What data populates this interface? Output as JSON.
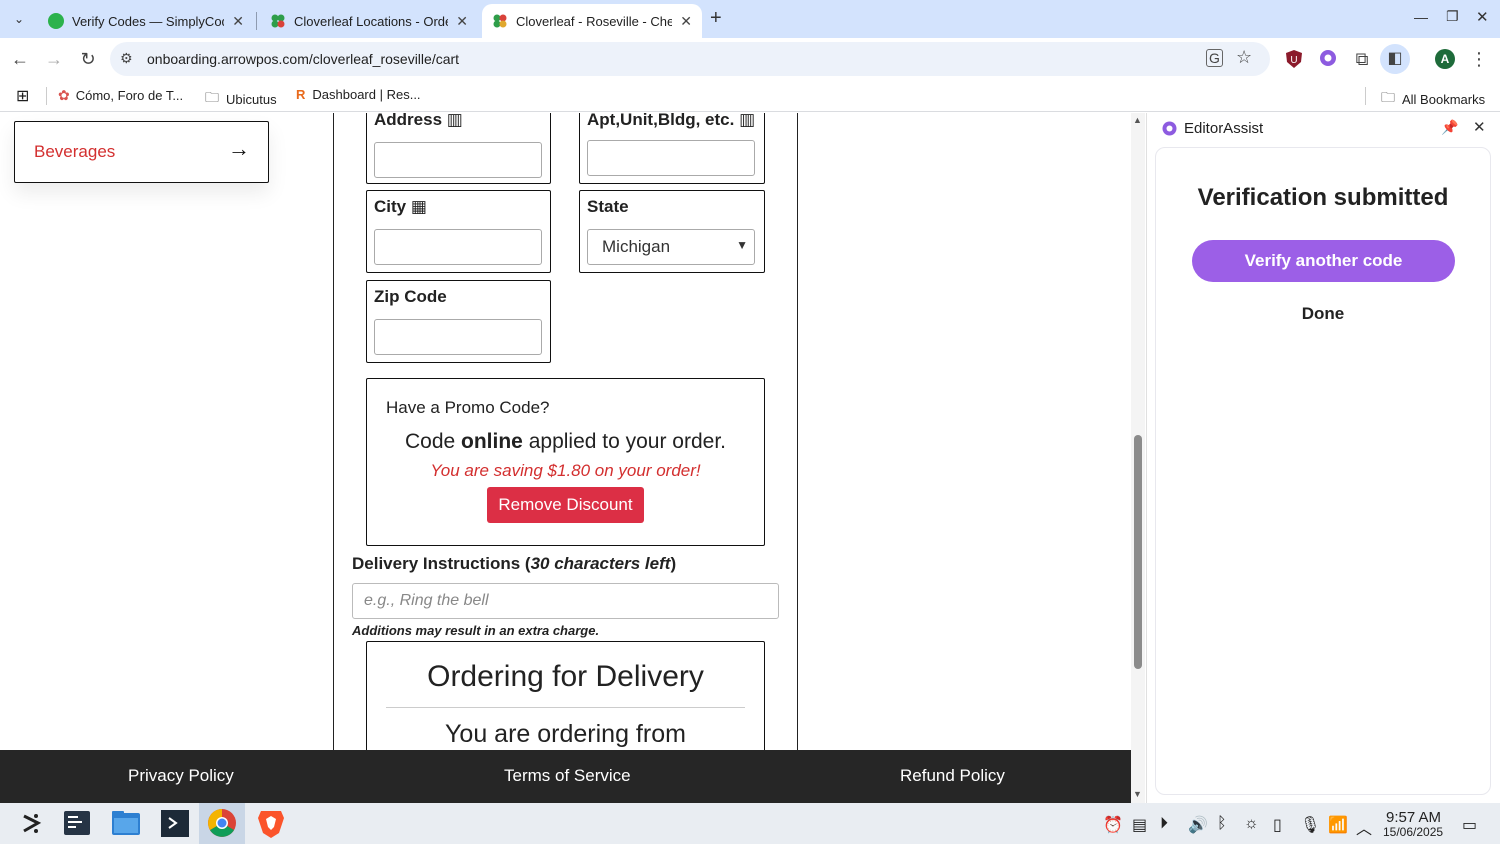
{
  "browser": {
    "tabs": [
      {
        "title": "Verify Codes — SimplyCode",
        "active": false
      },
      {
        "title": "Cloverleaf Locations - Orde",
        "active": false
      },
      {
        "title": "Cloverleaf - Roseville - Chec",
        "active": true
      }
    ],
    "url": "onboarding.arrowpos.com/cloverleaf_roseville/cart",
    "bookmarks": [
      "Cómo, Foro de T...",
      "Ubicutus",
      "Dashboard | Res..."
    ],
    "all_bookmarks": "All Bookmarks",
    "profile_initial": "A"
  },
  "page": {
    "category": "Beverages",
    "fields": {
      "address": "Address",
      "apt": "Apt,Unit,Bldg, etc.",
      "city": "City",
      "state": "State",
      "state_value": "Michigan",
      "zip": "Zip Code"
    },
    "promo": {
      "title": "Have a Promo Code?",
      "line_pre": "Code ",
      "code": "online",
      "line_post": " applied to your order.",
      "saving": "You are saving $1.80 on your order!",
      "remove": "Remove Discount"
    },
    "delivery": {
      "label_pre": "Delivery Instructions (",
      "label_count": "30 characters left",
      "label_post": ")",
      "placeholder": "e.g., Ring the bell",
      "note": "Additions may result in an extra charge.",
      "box_title": "Ordering for Delivery",
      "box_sub": "You are ordering from"
    },
    "footer": [
      "Privacy Policy",
      "Terms of Service",
      "Refund Policy"
    ]
  },
  "panel": {
    "title": "EditorAssist",
    "heading": "Verification submitted",
    "verify_button": "Verify another code",
    "done": "Done",
    "accent": "#9c5fe7"
  },
  "taskbar": {
    "time": "9:57 AM",
    "date": "15/06/2025"
  }
}
